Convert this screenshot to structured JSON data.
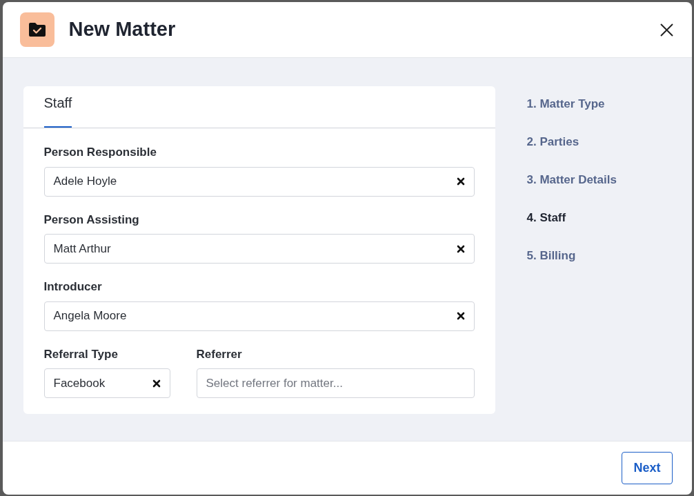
{
  "dialog": {
    "title": "New Matter"
  },
  "card": {
    "tab": {
      "label": "Staff",
      "selected": true
    },
    "fields": [
      {
        "label": "Person Responsible",
        "value": "Adele Hoyle"
      },
      {
        "label": "Person Assisting",
        "value": "Matt Arthur"
      },
      {
        "label": "Introducer",
        "value": "Angela Moore"
      }
    ],
    "row_fields": [
      {
        "label": "Referral Type",
        "value": "Facebook"
      },
      {
        "label": "Referrer",
        "placeholder": "Select referrer for matter..."
      }
    ]
  },
  "steps": [
    {
      "label": "1. Matter Type",
      "selected": false
    },
    {
      "label": "2. Parties",
      "selected": false
    },
    {
      "label": "3. Matter Details",
      "selected": false
    },
    {
      "label": "4. Staff",
      "selected": true
    },
    {
      "label": "5. Billing",
      "selected": false
    }
  ],
  "buttons": [
    {
      "label": "Next"
    }
  ]
}
